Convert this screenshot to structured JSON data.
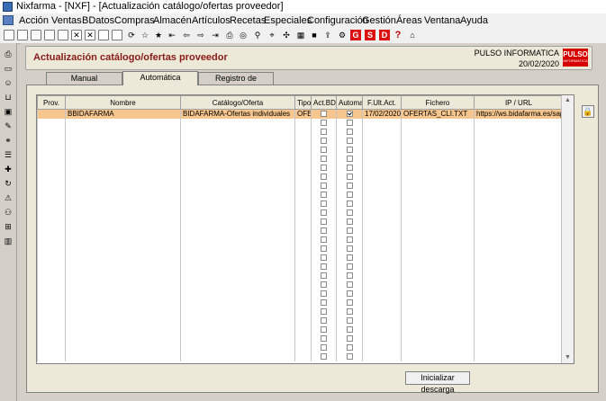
{
  "window": {
    "title": "Nixfarma - [NXF] - [Actualización catálogo/ofertas proveedor]"
  },
  "menu": [
    "Acción",
    "Ventas",
    "BDatos",
    "Compras",
    "Almacén",
    "Artículos",
    "Recetas",
    "Especiales",
    "Configuración",
    "Gestión",
    "Áreas",
    "Ventana",
    "Ayuda"
  ],
  "toolbar": {
    "g1": "G",
    "s": "S",
    "d": "D",
    "help": "?"
  },
  "header": {
    "title": "Actualización catálogo/ofertas proveedor",
    "company": "PULSO INFORMATICA",
    "date": "20/02/2020",
    "logo_big": "PULSO",
    "logo_small": "INFORMATICA"
  },
  "tabs": [
    "Manual",
    "Automática",
    "Registro de actividad"
  ],
  "grid": {
    "columns": [
      "Prov.",
      "Nombre",
      "Catálogo/Oferta",
      "Tipo",
      "Act.BD",
      "Automat.",
      "F.Ult.Act.",
      "Fichero",
      "IP / URL"
    ],
    "rows": [
      {
        "prov": "",
        "nombre": "BBIDAFARMA",
        "catalogo": "BIDAFARMA-Ofertas individuales",
        "tipo": "OFE",
        "actbd": false,
        "automat": true,
        "fecha": "17/02/2020",
        "fichero": "OFERTAS_CLI.TXT",
        "url": "https://ws.bidafarma.es/sap/b"
      }
    ],
    "empty_rows": 27
  },
  "buttons": {
    "inicializar": "Inicializar descarga"
  },
  "colors": {
    "accent": "#8b1a1a",
    "selected_row": "#f6c68e",
    "logo": "#d60000"
  }
}
